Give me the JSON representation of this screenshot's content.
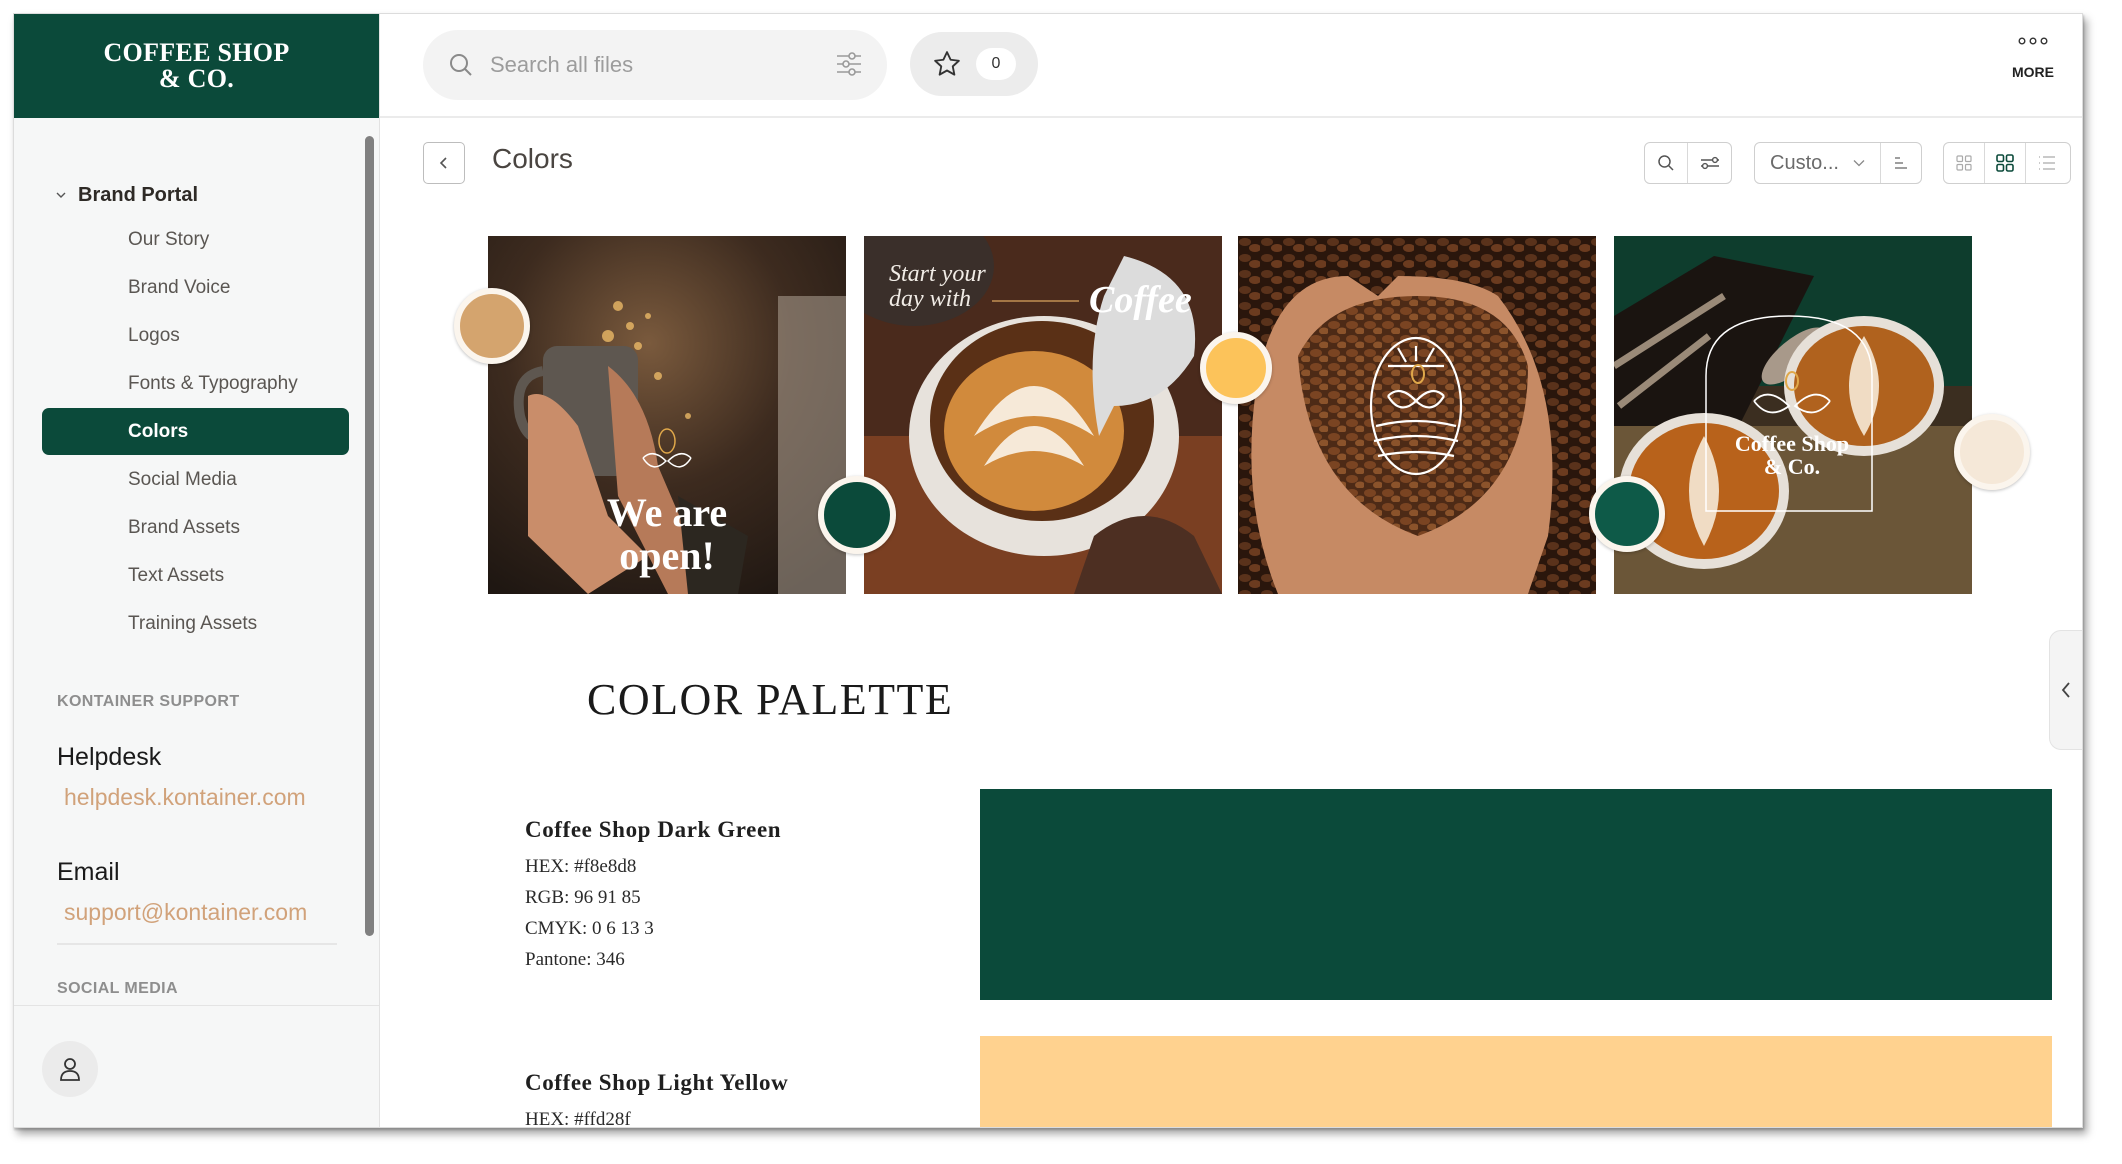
{
  "brand": {
    "line1": "COFFEE SHOP",
    "line2": "& CO."
  },
  "sidebar": {
    "section_label": "Brand Portal",
    "items": [
      {
        "label": "Our Story",
        "active": false
      },
      {
        "label": "Brand Voice",
        "active": false
      },
      {
        "label": "Logos",
        "active": false
      },
      {
        "label": "Fonts & Typography",
        "active": false
      },
      {
        "label": "Colors",
        "active": true
      },
      {
        "label": "Social Media",
        "active": false
      },
      {
        "label": "Brand Assets",
        "active": false
      },
      {
        "label": "Text Assets",
        "active": false
      },
      {
        "label": "Training Assets",
        "active": false
      }
    ],
    "support_title": "KONTAINER SUPPORT",
    "helpdesk_label": "Helpdesk",
    "helpdesk_link": "helpdesk.kontainer.com",
    "email_label": "Email",
    "email_link": "support@kontainer.com",
    "social_title": "SOCIAL MEDIA"
  },
  "topbar": {
    "search_placeholder": "Search all files",
    "favorites_count": "0",
    "more_label": "MORE"
  },
  "page": {
    "title": "Colors",
    "sort_label": "Custo...",
    "view_mode": "medium-grid"
  },
  "gallery": {
    "tiles": [
      {
        "caption": "We are open!",
        "caption_line1": "We are",
        "caption_line2": "open!"
      },
      {
        "caption_line1": "Start your",
        "caption_line2": "day with",
        "caption_emph": "Coffee"
      },
      {
        "caption": ""
      },
      {
        "caption_line1": "Coffee Shop",
        "caption_line2": "& Co."
      }
    ],
    "dot_colors": {
      "tan": "#d4a46e",
      "yellow": "#fcc35a",
      "green": "#0b4a3a",
      "green_alt": "#0e5a48",
      "cream": "#f5e8d8"
    }
  },
  "palette": {
    "title": "COLOR PALETTE",
    "colors": [
      {
        "name": "Coffee Shop Dark Green",
        "hex_line": "HEX: #f8e8d8",
        "rgb_line": "RGB: 96 91 85",
        "cmyk_line": "CMYK: 0 6 13 3",
        "pantone_line": "Pantone: 346",
        "swatch": "#0b4a3a"
      },
      {
        "name": "Coffee Shop Light Yellow",
        "hex_line": "HEX: #ffd28f",
        "swatch": "#ffd28f"
      }
    ]
  },
  "colors": {
    "brand_green": "#0b4a3a",
    "link_tan": "#d1a27a"
  }
}
